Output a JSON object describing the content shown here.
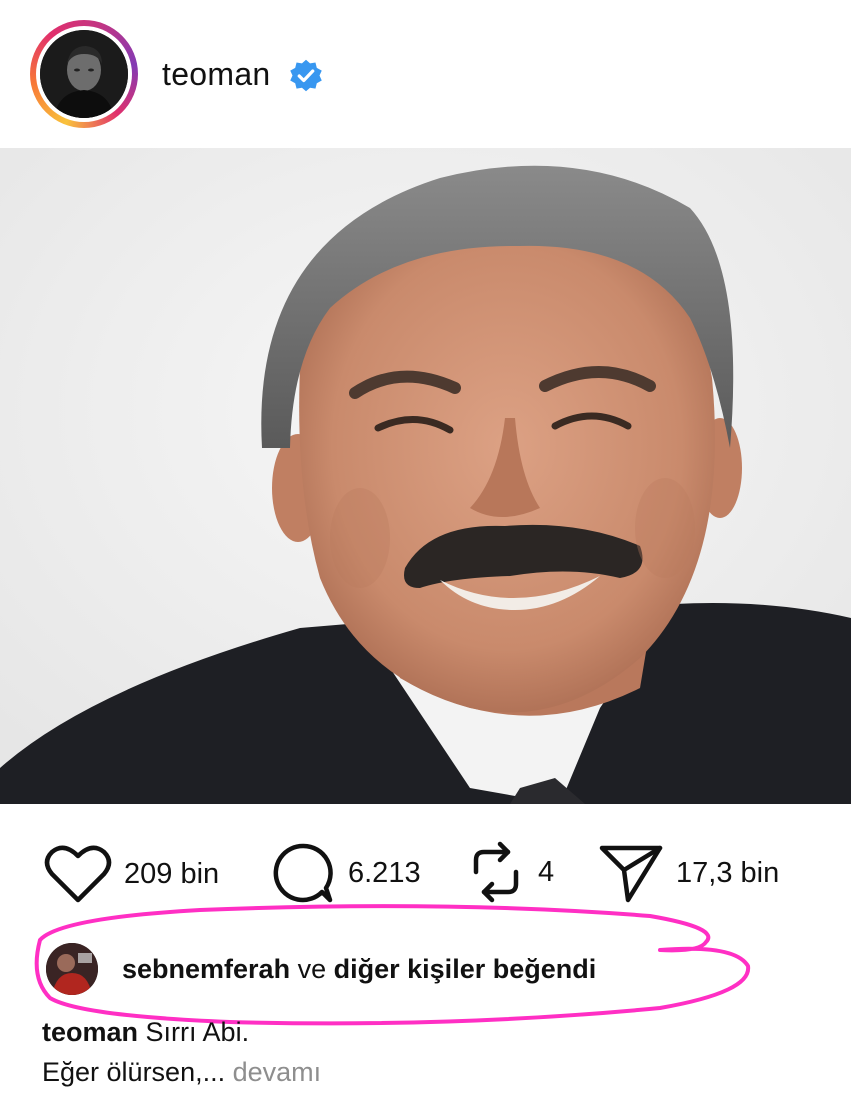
{
  "header": {
    "username": "teoman",
    "verified": true
  },
  "post": {
    "image_description": "portrait photo"
  },
  "actions": {
    "likes": "209 bin",
    "comments": "6.213",
    "reposts": "4",
    "shares": "17,3 bin"
  },
  "liked_by": {
    "user": "sebnemferah",
    "suffix_plain": "ve",
    "suffix_bold": "diğer kişiler",
    "suffix_end": "beğendi"
  },
  "caption": {
    "author": "teoman",
    "line1": "Sırrı Abi.",
    "line2": "Eğer ölürsen,...",
    "more": "devamı"
  },
  "colors": {
    "verified": "#3897f0",
    "highlight": "#ff2fc4",
    "muted": "#8e8e8e"
  }
}
